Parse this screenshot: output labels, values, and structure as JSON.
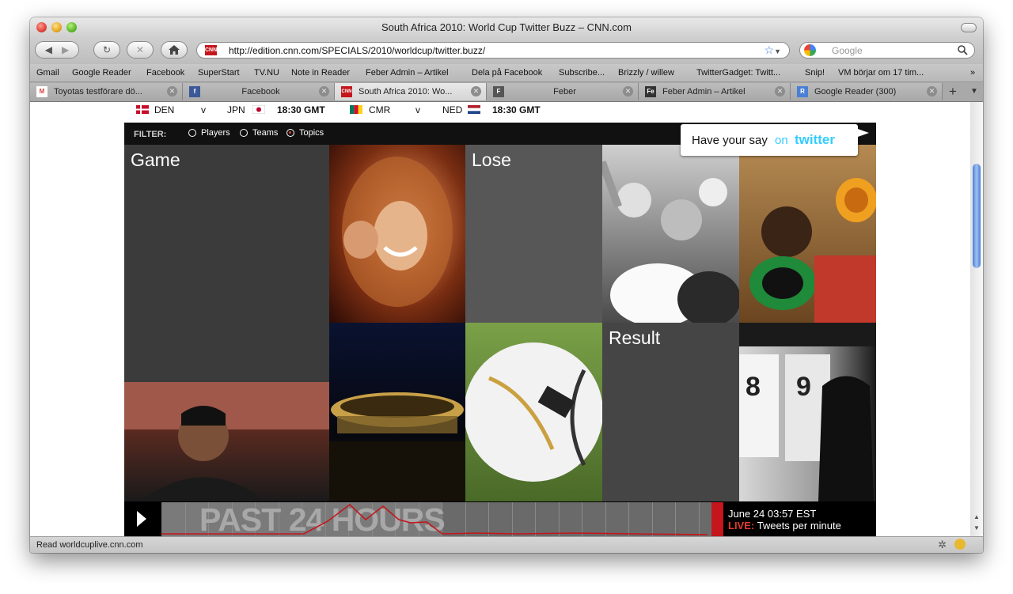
{
  "window": {
    "title": "South Africa 2010: World Cup Twitter Buzz – CNN.com"
  },
  "toolbar": {
    "url": "http://edition.cnn.com/SPECIALS/2010/worldcup/twitter.buzz/",
    "search_placeholder": "Google"
  },
  "bookmarks": [
    "Gmail",
    "Google Reader",
    "Facebook",
    "SuperStart",
    "TV.NU",
    "Note in Reader",
    "Feber Admin – Artikel",
    "Dela på Facebook",
    "Subscribe...",
    "Brizzly / willew",
    "TwitterGadget: Twitt...",
    "Snip!",
    "VM börjar om 17 tim..."
  ],
  "bookmarks_more": "»",
  "tabs": [
    {
      "label": "Toyotas testförare dö...",
      "fav": "M",
      "color": "#d44"
    },
    {
      "label": "Facebook",
      "fav": "f",
      "color": "#3b5998"
    },
    {
      "label": "South Africa 2010: Wo...",
      "fav": "CNN",
      "color": "#c4161c"
    },
    {
      "label": "Feber",
      "fav": "F",
      "color": "#555"
    },
    {
      "label": "Feber Admin – Artikel",
      "fav": "Fe",
      "color": "#333"
    },
    {
      "label": "Google Reader (300)",
      "fav": "R",
      "color": "#4a7fd6"
    }
  ],
  "tab_new": "+",
  "matches": [
    {
      "home": "DEN",
      "v": "v",
      "away": "JPN",
      "time": "18:30 GMT"
    },
    {
      "home": "CMR",
      "v": "v",
      "away": "NED",
      "time": "18:30 GMT"
    }
  ],
  "filter": {
    "label": "FILTER:",
    "options": [
      "Players",
      "Teams",
      "Topics"
    ],
    "selected": "Topics"
  },
  "twitter_prompt": {
    "text": "Have your say",
    "on": "on",
    "brand": "twitter"
  },
  "tiles": {
    "game": "Game",
    "lose": "Lose",
    "result": "Result"
  },
  "timeline": {
    "title": "PAST 24 HOURS",
    "date": "June 24 03:57 EST",
    "live_label": "LIVE:",
    "live_text": "Tweets per minute"
  },
  "status": {
    "text": "Read worldcuplive.cnn.com"
  },
  "colors": {
    "cnn_red": "#c4161c",
    "twitter_blue": "#33ccff",
    "live_red": "#e23b2e",
    "selection_blue": "#3d6fd4"
  }
}
